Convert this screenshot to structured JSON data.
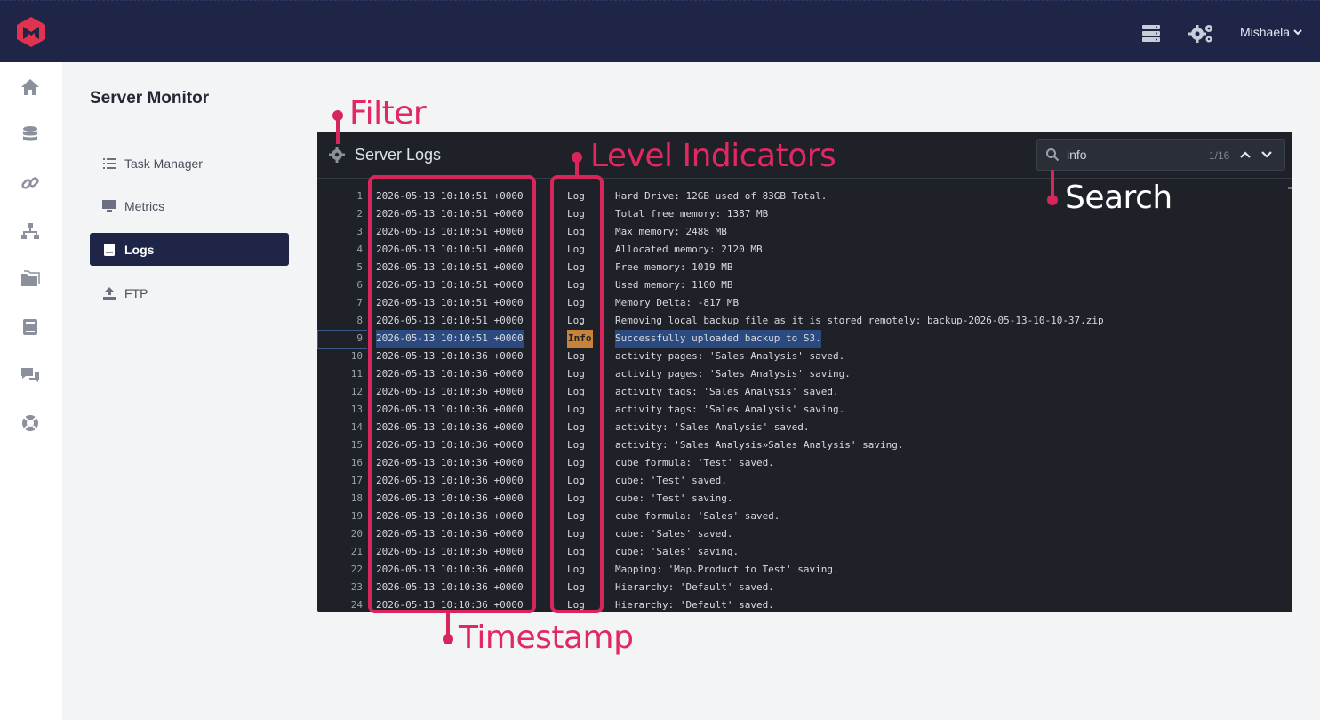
{
  "header": {
    "user_name": "Mishaela",
    "icons": [
      "logo-icon",
      "server-icon",
      "gears-icon",
      "chevron-down-icon"
    ]
  },
  "rail": {
    "items": [
      "home-icon",
      "database-icon",
      "link-icon",
      "network-icon",
      "folders-icon",
      "book-icon",
      "chat-icon",
      "lifebuoy-icon"
    ]
  },
  "sidebar": {
    "title": "Server Monitor",
    "items": [
      {
        "label": "Task Manager",
        "icon": "tasks-icon"
      },
      {
        "label": "Metrics",
        "icon": "monitor-icon"
      },
      {
        "label": "Logs",
        "icon": "logbook-icon",
        "active": true
      },
      {
        "label": "FTP",
        "icon": "upload-icon"
      }
    ]
  },
  "panel": {
    "title": "Server Logs",
    "search": {
      "value": "info",
      "count": "1/16"
    },
    "lines": [
      {
        "n": "1",
        "ts": "2026-05-13 10:10:51 +0000",
        "lv": "Log",
        "msg": "Hard Drive: 12GB used of 83GB Total."
      },
      {
        "n": "2",
        "ts": "2026-05-13 10:10:51 +0000",
        "lv": "Log",
        "msg": "Total free memory: 1387 MB"
      },
      {
        "n": "3",
        "ts": "2026-05-13 10:10:51 +0000",
        "lv": "Log",
        "msg": "Max memory: 2488 MB"
      },
      {
        "n": "4",
        "ts": "2026-05-13 10:10:51 +0000",
        "lv": "Log",
        "msg": "Allocated memory: 2120 MB"
      },
      {
        "n": "5",
        "ts": "2026-05-13 10:10:51 +0000",
        "lv": "Log",
        "msg": "Free memory: 1019 MB"
      },
      {
        "n": "6",
        "ts": "2026-05-13 10:10:51 +0000",
        "lv": "Log",
        "msg": "Used memory: 1100 MB"
      },
      {
        "n": "7",
        "ts": "2026-05-13 10:10:51 +0000",
        "lv": "Log",
        "msg": "Memory Delta: -817 MB"
      },
      {
        "n": "8",
        "ts": "2026-05-13 10:10:51 +0000",
        "lv": "Log",
        "msg": "Removing local backup file as it is stored remotely: backup-2026-05-13-10-10-37.zip"
      },
      {
        "n": "9",
        "ts": "2026-05-13 10:10:51 +0000",
        "lv": "Info",
        "msg": "Successfully uploaded backup to S3.",
        "highlight": true
      },
      {
        "n": "10",
        "ts": "2026-05-13 10:10:36 +0000",
        "lv": "Log",
        "msg": "activity pages: 'Sales Analysis' saved."
      },
      {
        "n": "11",
        "ts": "2026-05-13 10:10:36 +0000",
        "lv": "Log",
        "msg": "activity pages: 'Sales Analysis' saving."
      },
      {
        "n": "12",
        "ts": "2026-05-13 10:10:36 +0000",
        "lv": "Log",
        "msg": "activity tags: 'Sales Analysis' saved."
      },
      {
        "n": "13",
        "ts": "2026-05-13 10:10:36 +0000",
        "lv": "Log",
        "msg": "activity tags: 'Sales Analysis' saving."
      },
      {
        "n": "14",
        "ts": "2026-05-13 10:10:36 +0000",
        "lv": "Log",
        "msg": "activity: 'Sales Analysis' saved."
      },
      {
        "n": "15",
        "ts": "2026-05-13 10:10:36 +0000",
        "lv": "Log",
        "msg": "activity: 'Sales Analysis»Sales Analysis' saving."
      },
      {
        "n": "16",
        "ts": "2026-05-13 10:10:36 +0000",
        "lv": "Log",
        "msg": "cube formula: 'Test' saved."
      },
      {
        "n": "17",
        "ts": "2026-05-13 10:10:36 +0000",
        "lv": "Log",
        "msg": "cube: 'Test' saved."
      },
      {
        "n": "18",
        "ts": "2026-05-13 10:10:36 +0000",
        "lv": "Log",
        "msg": "cube: 'Test' saving."
      },
      {
        "n": "19",
        "ts": "2026-05-13 10:10:36 +0000",
        "lv": "Log",
        "msg": "cube formula: 'Sales' saved."
      },
      {
        "n": "20",
        "ts": "2026-05-13 10:10:36 +0000",
        "lv": "Log",
        "msg": "cube: 'Sales' saved."
      },
      {
        "n": "21",
        "ts": "2026-05-13 10:10:36 +0000",
        "lv": "Log",
        "msg": "cube: 'Sales' saving."
      },
      {
        "n": "22",
        "ts": "2026-05-13 10:10:36 +0000",
        "lv": "Log",
        "msg": "Mapping: 'Map.Product to Test' saving."
      },
      {
        "n": "23",
        "ts": "2026-05-13 10:10:36 +0000",
        "lv": "Log",
        "msg": "Hierarchy: 'Default' saved."
      },
      {
        "n": "24",
        "ts": "2026-05-13 10:10:36 +0000",
        "lv": "Log",
        "msg": "Hierarchy: 'Default' saved."
      }
    ]
  },
  "annotations": {
    "filter": "Filter",
    "level": "Level Indicators",
    "search": "Search",
    "timestamp": "Timestamp",
    "color": "#d6265b"
  }
}
